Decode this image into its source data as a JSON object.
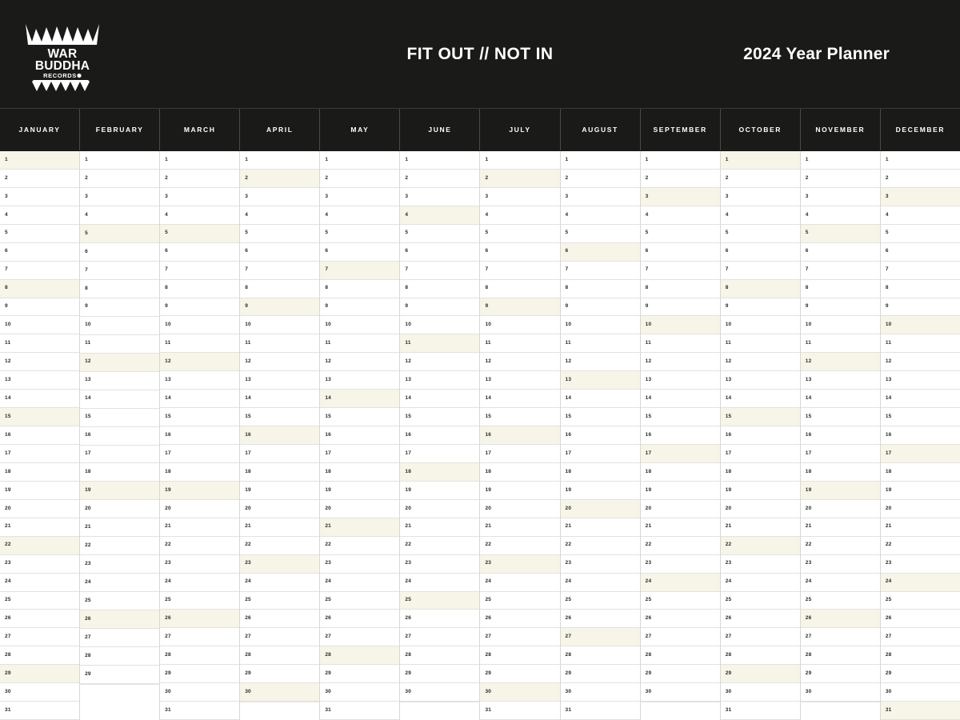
{
  "header": {
    "logo": {
      "line1": "WAR",
      "line2": "BUDDHA",
      "line3": "RECORDS",
      "name": "war-buddha-records-logo"
    },
    "tagline": "FIT OUT // NOT IN",
    "year_title": "2024 Year Planner",
    "background_color": "#1a1a18",
    "text_color": "#ffffff"
  },
  "colors": {
    "dark": "#1a1a18",
    "cell_bg": "#ffffff",
    "highlight": "#f7f4e8",
    "grid_line": "#e2e2de",
    "column_line": "#d8d8d4",
    "day_text": "#2a2a28"
  },
  "grid": {
    "row_count": 31,
    "month_count": 12
  },
  "months": [
    {
      "label": "JANUARY",
      "days": 31,
      "highlighted": [
        1,
        8,
        15,
        22,
        29
      ]
    },
    {
      "label": "FEBRUARY",
      "days": 29,
      "highlighted": [
        5,
        12,
        19,
        26
      ]
    },
    {
      "label": "MARCH",
      "days": 31,
      "highlighted": [
        5,
        12,
        19,
        26
      ]
    },
    {
      "label": "APRIL",
      "days": 30,
      "highlighted": [
        2,
        9,
        16,
        23,
        30
      ]
    },
    {
      "label": "MAY",
      "days": 31,
      "highlighted": [
        7,
        14,
        21,
        28
      ]
    },
    {
      "label": "JUNE",
      "days": 30,
      "highlighted": [
        4,
        11,
        18,
        25
      ]
    },
    {
      "label": "JULY",
      "days": 31,
      "highlighted": [
        2,
        9,
        16,
        23,
        30
      ]
    },
    {
      "label": "AUGUST",
      "days": 31,
      "highlighted": [
        6,
        13,
        20,
        27
      ]
    },
    {
      "label": "SEPTEMBER",
      "days": 30,
      "highlighted": [
        3,
        10,
        17,
        24
      ]
    },
    {
      "label": "OCTOBER",
      "days": 31,
      "highlighted": [
        1,
        8,
        15,
        22,
        29
      ]
    },
    {
      "label": "NOVEMBER",
      "days": 30,
      "highlighted": [
        5,
        12,
        19,
        26
      ]
    },
    {
      "label": "DECEMBER",
      "days": 31,
      "highlighted": [
        3,
        10,
        17,
        24,
        31
      ]
    }
  ]
}
